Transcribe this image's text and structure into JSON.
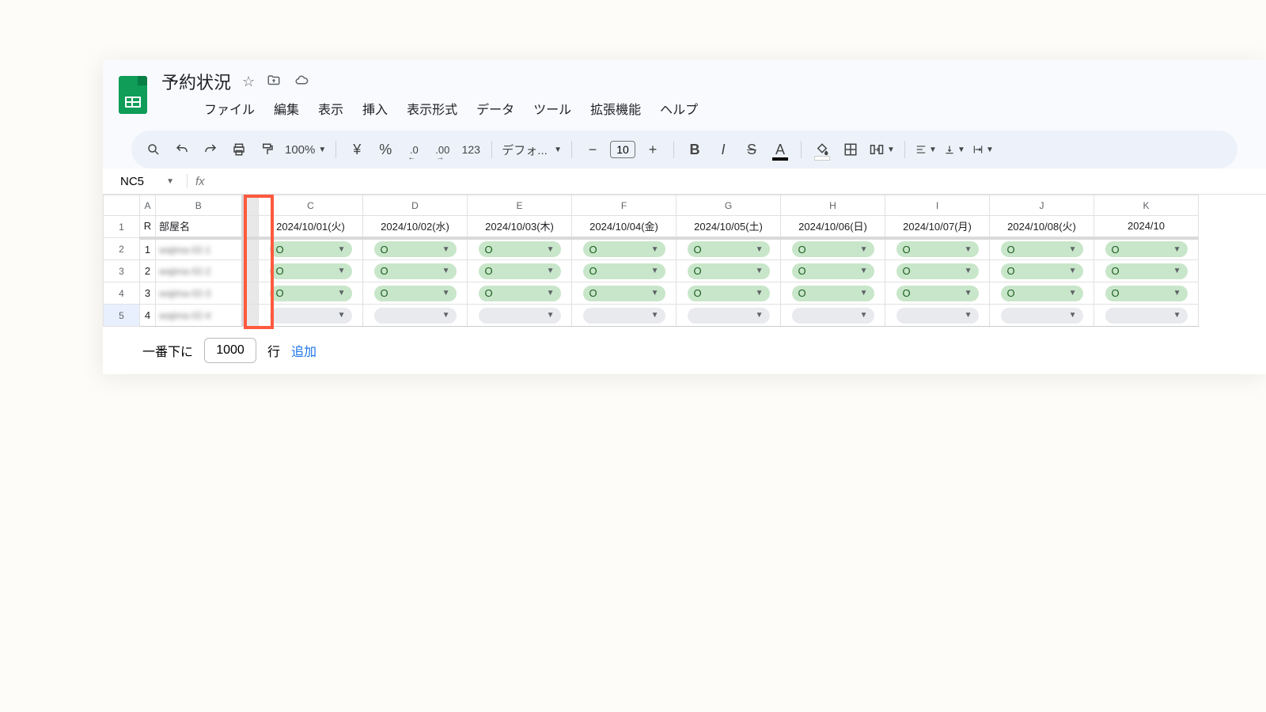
{
  "header": {
    "doc_title": "予約状況",
    "menu": [
      "ファイル",
      "編集",
      "表示",
      "挿入",
      "表示形式",
      "データ",
      "ツール",
      "拡張機能",
      "ヘルプ"
    ]
  },
  "toolbar": {
    "zoom": "100%",
    "currency": "¥",
    "percent": "%",
    "dec_dec": ".0",
    "inc_dec": ".00",
    "numfmt": "123",
    "font": "デフォ...",
    "font_size": "10"
  },
  "formula_bar": {
    "cell_ref": "NC5"
  },
  "columns": [
    "A",
    "B",
    "",
    "C",
    "D",
    "E",
    "F",
    "G",
    "H",
    "I",
    "J",
    "K"
  ],
  "header_row": {
    "a": "R",
    "b": "部屋名",
    "dates": [
      "2024/10/01(火)",
      "2024/10/02(水)",
      "2024/10/03(木)",
      "2024/10/04(金)",
      "2024/10/05(土)",
      "2024/10/06(日)",
      "2024/10/07(月)",
      "2024/10/08(火)",
      "2024/10"
    ]
  },
  "rows": [
    {
      "n": "2",
      "a": "1",
      "b": "wajima-02-1",
      "cells": [
        "O",
        "O",
        "O",
        "O",
        "O",
        "O",
        "O",
        "O",
        "O"
      ]
    },
    {
      "n": "3",
      "a": "2",
      "b": "wajima-02-2",
      "cells": [
        "O",
        "O",
        "O",
        "O",
        "O",
        "O",
        "O",
        "O",
        "O"
      ]
    },
    {
      "n": "4",
      "a": "3",
      "b": "wajima-02-3",
      "cells": [
        "O",
        "O",
        "O",
        "O",
        "O",
        "O",
        "O",
        "O",
        "O"
      ]
    },
    {
      "n": "5",
      "a": "4",
      "b": "wajima-02-4",
      "cells": [
        "",
        "",
        "",
        "",
        "",
        "",
        "",
        "",
        ""
      ]
    }
  ],
  "add_rows": {
    "prefix": "一番下に",
    "value": "1000",
    "suffix": "行",
    "link": "追加"
  }
}
